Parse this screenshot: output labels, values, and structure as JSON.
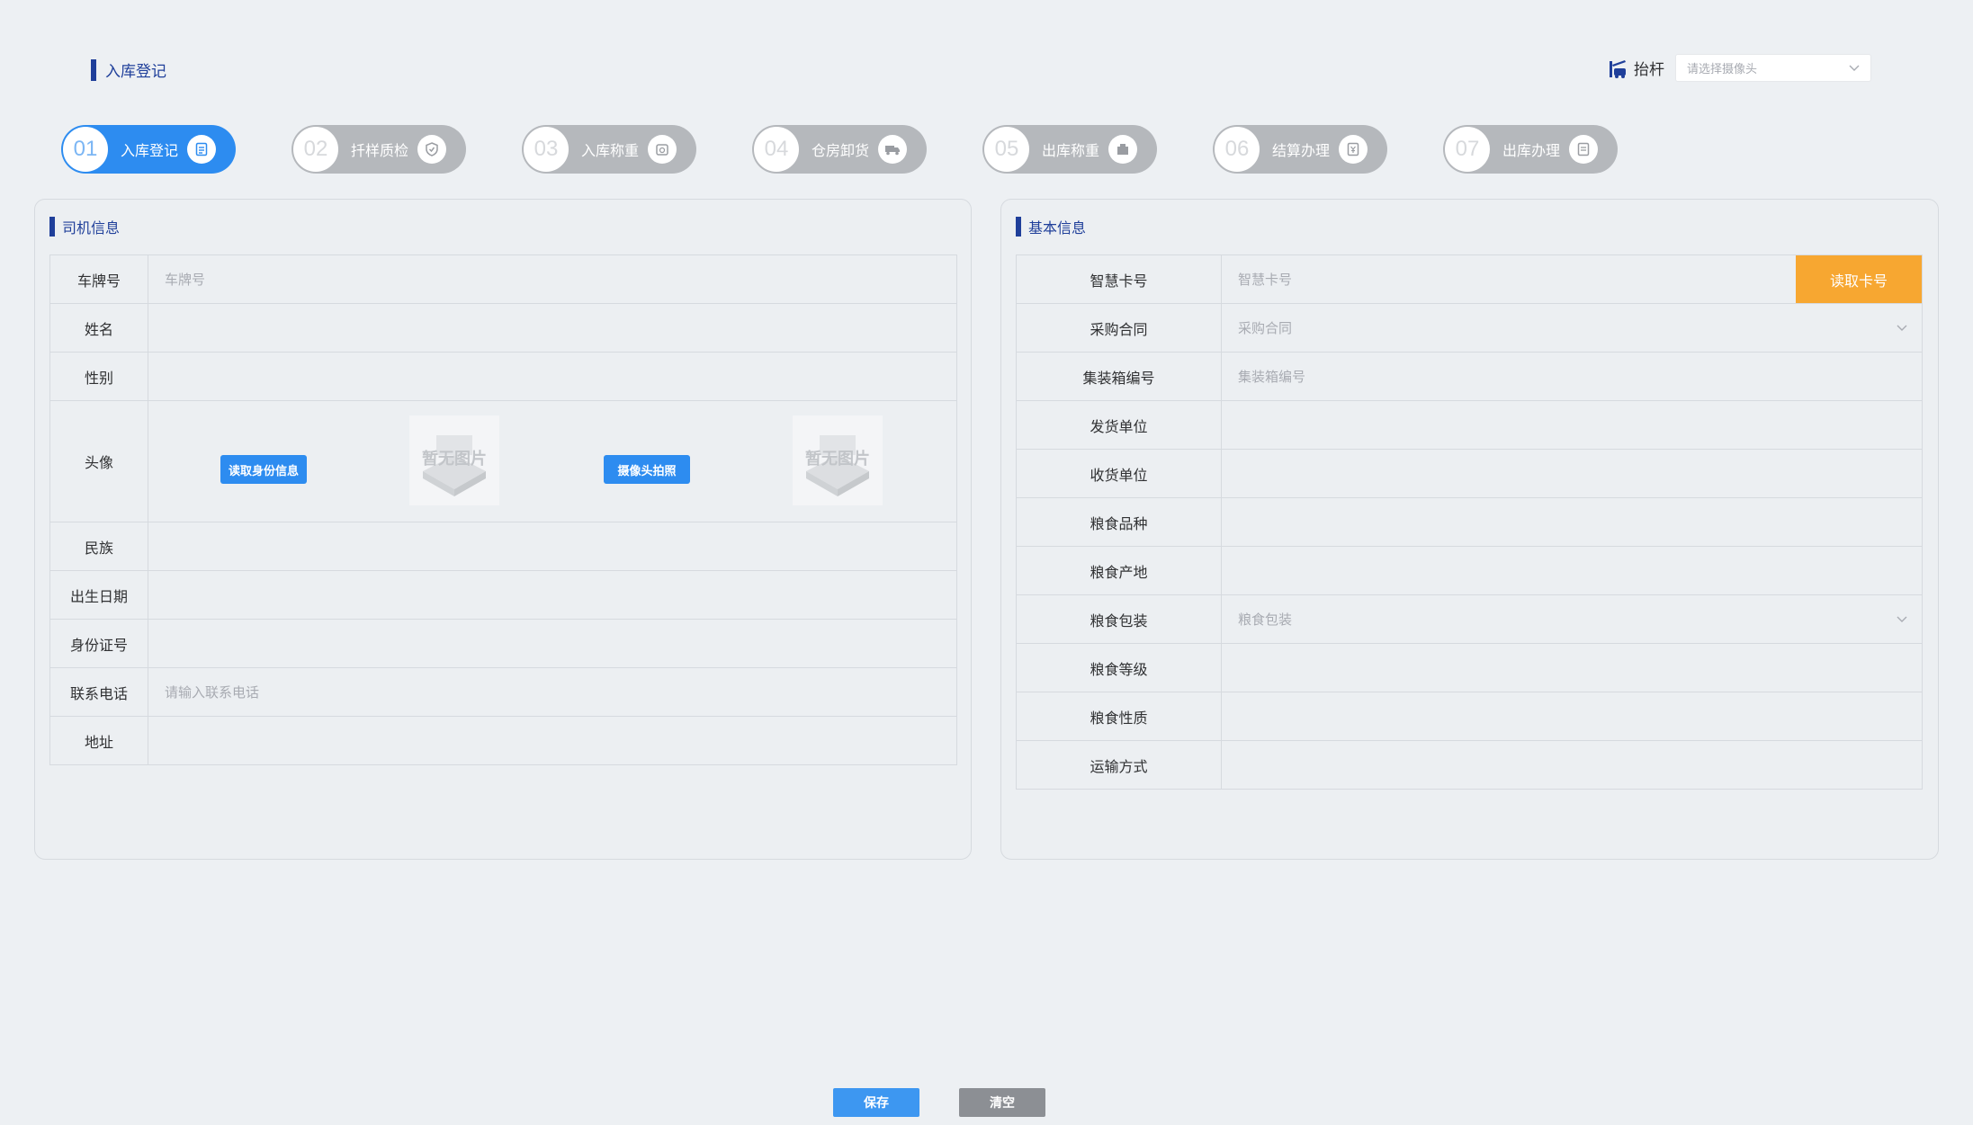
{
  "header": {
    "title": "入库登记",
    "barrier_label": "抬杆",
    "camera_placeholder": "请选择摄像头"
  },
  "steps": [
    {
      "num": "01",
      "label": "入库登记",
      "icon": "clipboard-icon",
      "active": true
    },
    {
      "num": "02",
      "label": "扦样质检",
      "icon": "shield-check-icon",
      "active": false
    },
    {
      "num": "03",
      "label": "入库称重",
      "icon": "scale-icon",
      "active": false
    },
    {
      "num": "04",
      "label": "仓房卸货",
      "icon": "truck-icon",
      "active": false
    },
    {
      "num": "05",
      "label": "出库称重",
      "icon": "scale-out-icon",
      "active": false
    },
    {
      "num": "06",
      "label": "结算办理",
      "icon": "bill-icon",
      "active": false
    },
    {
      "num": "07",
      "label": "出库办理",
      "icon": "document-icon",
      "active": false
    }
  ],
  "driver": {
    "title": "司机信息",
    "plate_label": "车牌号",
    "plate_placeholder": "车牌号",
    "name_label": "姓名",
    "gender_label": "性别",
    "avatar_label": "头像",
    "read_id_button": "读取身份信息",
    "camera_button": "摄像头拍照",
    "no_image_text": "暂无图片",
    "ethnicity_label": "民族",
    "birth_label": "出生日期",
    "id_label": "身份证号",
    "phone_label": "联系电话",
    "phone_placeholder": "请输入联系电话",
    "address_label": "地址"
  },
  "basic": {
    "title": "基本信息",
    "card_label": "智慧卡号",
    "card_placeholder": "智慧卡号",
    "read_card_button": "读取卡号",
    "contract_label": "采购合同",
    "contract_placeholder": "采购合同",
    "container_label": "集装箱编号",
    "container_placeholder": "集装箱编号",
    "sender_label": "发货单位",
    "receiver_label": "收货单位",
    "variety_label": "粮食品种",
    "origin_label": "粮食产地",
    "package_label": "粮食包装",
    "package_placeholder": "粮食包装",
    "grade_label": "粮食等级",
    "nature_label": "粮食性质",
    "transport_label": "运输方式"
  },
  "actions": {
    "save": "保存",
    "clear": "清空"
  },
  "colors": {
    "primary": "#2d8cf0",
    "title_blue": "#1f3f9a",
    "orange": "#f7a731",
    "step_inactive": "#b5b8bc"
  }
}
